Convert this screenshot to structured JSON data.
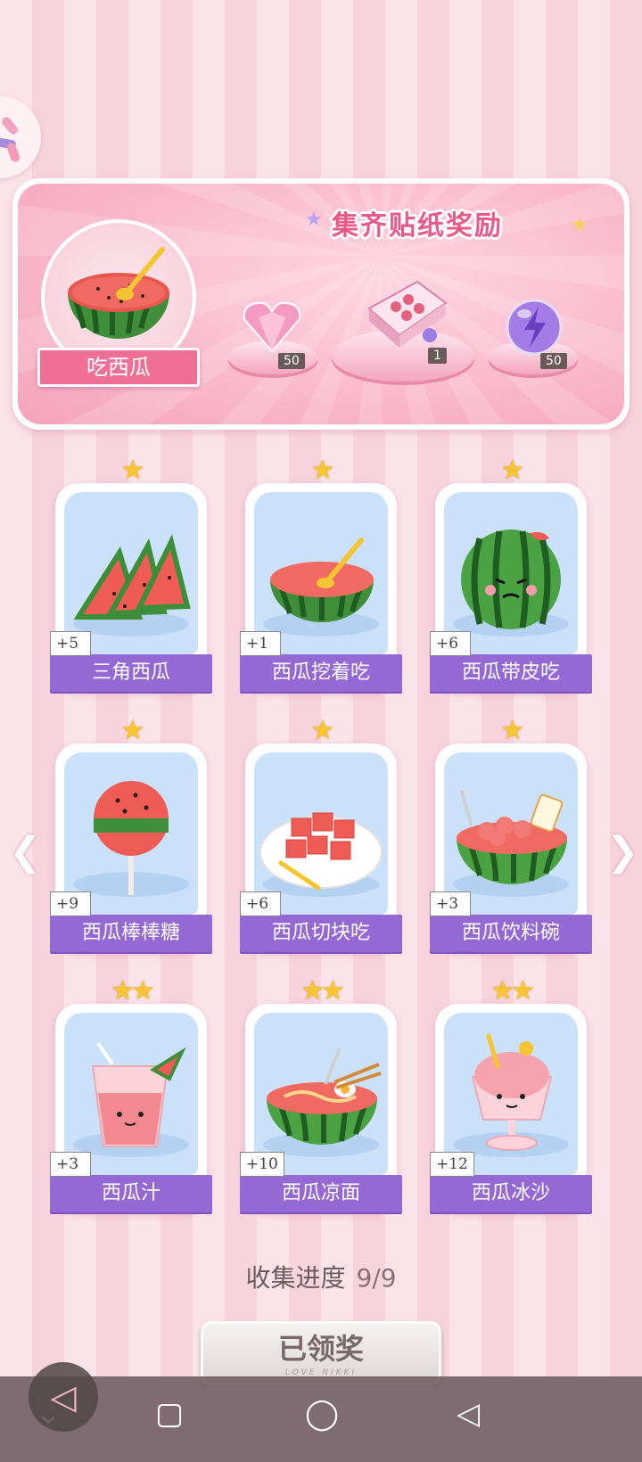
{
  "banner": {
    "title": "集齐贴纸奖励",
    "hero_label": "吃西瓜",
    "rewards": [
      {
        "icon": "pink-diamond-icon",
        "count": "50"
      },
      {
        "icon": "gift-box-icon",
        "count": "1"
      },
      {
        "icon": "energy-orb-icon",
        "count": "50"
      }
    ]
  },
  "cards": [
    {
      "name": "三角西瓜",
      "bonus": "+5",
      "stars": "★"
    },
    {
      "name": "西瓜挖着吃",
      "bonus": "+1",
      "stars": "★"
    },
    {
      "name": "西瓜带皮吃",
      "bonus": "+6",
      "stars": "★"
    },
    {
      "name": "西瓜棒棒糖",
      "bonus": "+9",
      "stars": "★"
    },
    {
      "name": "西瓜切块吃",
      "bonus": "+6",
      "stars": "★"
    },
    {
      "name": "西瓜饮料碗",
      "bonus": "+3",
      "stars": "★"
    },
    {
      "name": "西瓜汁",
      "bonus": "+3",
      "stars": "★★"
    },
    {
      "name": "西瓜凉面",
      "bonus": "+10",
      "stars": "★★"
    },
    {
      "name": "西瓜冰沙",
      "bonus": "+12",
      "stars": "★★"
    }
  ],
  "progress": {
    "label": "收集进度",
    "value": "9/9"
  },
  "claim": {
    "label": "已领奖",
    "sub": "LOVE NIKKI"
  },
  "colors": {
    "accent": "#9569d3",
    "pink": "#ef6f96",
    "star": "#f7c531"
  }
}
